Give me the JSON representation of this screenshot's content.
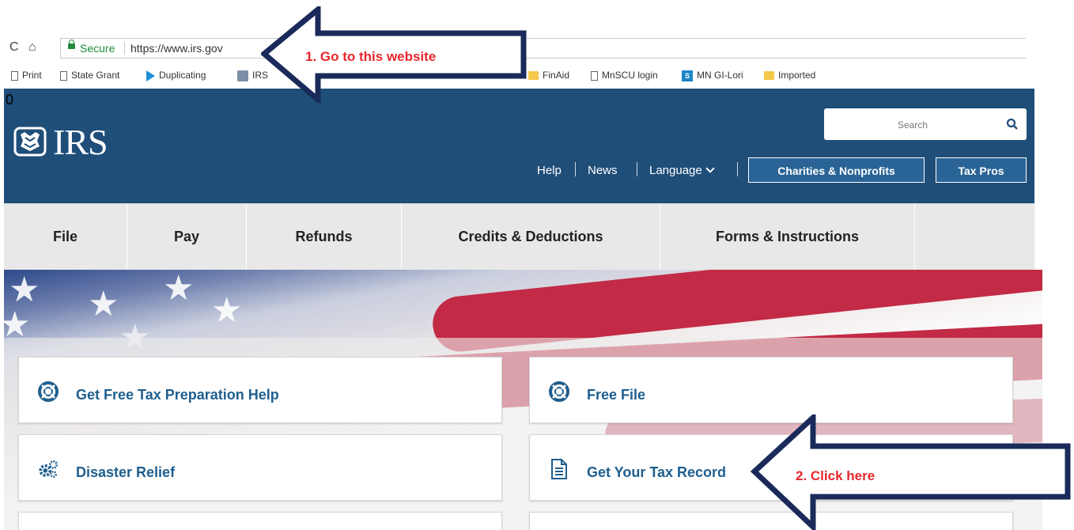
{
  "browser": {
    "reload_label": "C",
    "home_label": "⌂",
    "secure_label": "Secure",
    "url": "https://www.irs.gov",
    "bookmarks": [
      {
        "label": "Print",
        "icon": "page-icon"
      },
      {
        "label": "State Grant",
        "icon": "page-icon"
      },
      {
        "label": "Duplicating",
        "icon": "duplicating-icon"
      },
      {
        "label": "IRS",
        "icon": "irs-bookmark-icon"
      },
      {
        "label": "FinAid",
        "icon": "folder-icon"
      },
      {
        "label": "MnSCU login",
        "icon": "page-icon"
      },
      {
        "label": "MN GI-Lori",
        "icon": "sharepoint-icon"
      },
      {
        "label": "Imported",
        "icon": "folder-icon"
      }
    ]
  },
  "stray_mark": "0",
  "header": {
    "logo_text": "IRS",
    "search_placeholder": "Search",
    "links": [
      "Help",
      "News",
      "Language"
    ],
    "buttons": [
      "Charities & Nonprofits",
      "Tax Pros"
    ],
    "background_color": "#1f4e79"
  },
  "main_nav": {
    "tabs": [
      "File",
      "Pay",
      "Refunds",
      "Credits & Deductions",
      "Forms & Instructions"
    ]
  },
  "cards": [
    {
      "label": "Get Free Tax Preparation Help",
      "icon": "lifebuoy-icon"
    },
    {
      "label": "Free File",
      "icon": "lifebuoy-icon"
    },
    {
      "label": "Disaster Relief",
      "icon": "gears-icon"
    },
    {
      "label": "Get Your Tax Record",
      "icon": "document-icon"
    }
  ],
  "annotations": [
    {
      "text": "1.   Go to this website",
      "color": "#e8262b"
    },
    {
      "text": "2.   Click here",
      "color": "#e8262b"
    }
  ]
}
